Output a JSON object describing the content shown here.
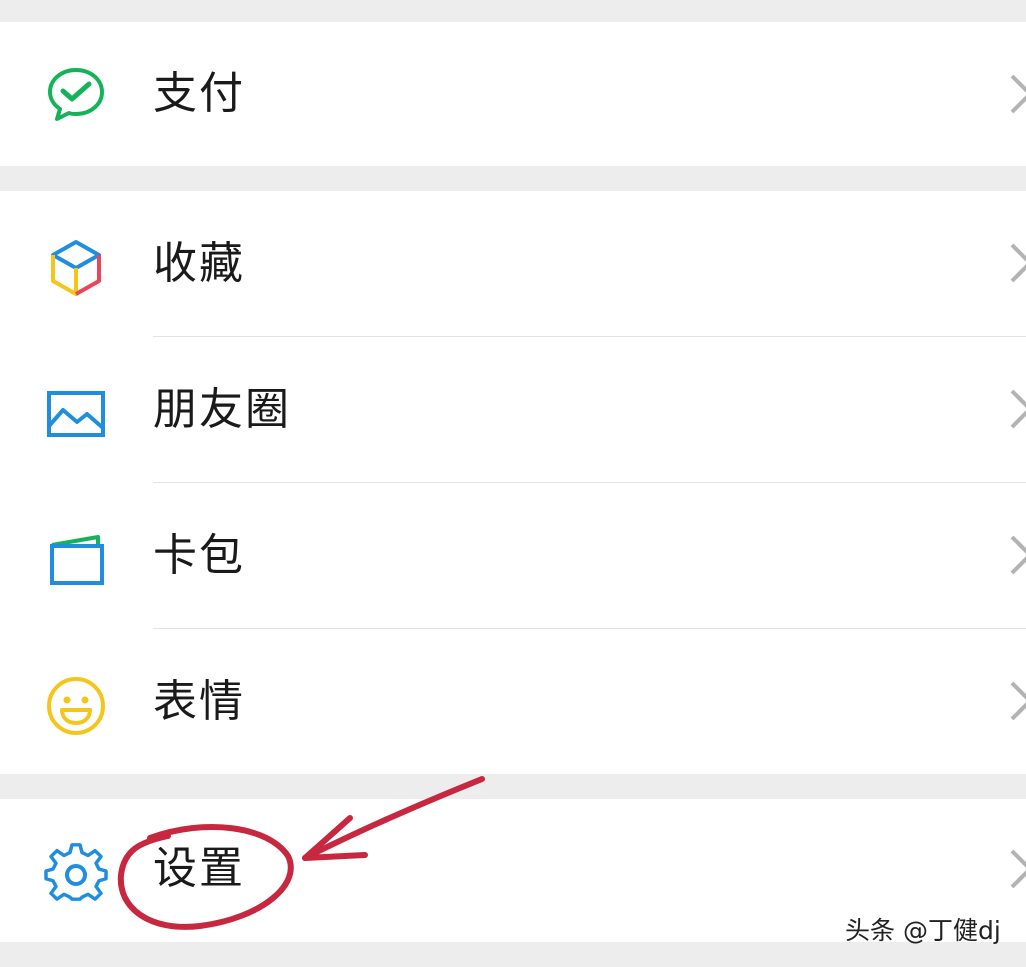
{
  "menu": {
    "pay": {
      "label": "支付",
      "icon": "wechat-pay-icon"
    },
    "favorites": {
      "label": "收藏",
      "icon": "favorites-cube-icon"
    },
    "moments": {
      "label": "朋友圈",
      "icon": "moments-picture-icon"
    },
    "cards": {
      "label": "卡包",
      "icon": "card-wallet-icon"
    },
    "stickers": {
      "label": "表情",
      "icon": "smiley-icon"
    },
    "settings": {
      "label": "设置",
      "icon": "gear-icon"
    }
  },
  "colors": {
    "background": "#ededed",
    "row": "#ffffff",
    "pay_green": "#14b35a",
    "blue": "#1f8de0",
    "smiley_yellow": "#f5c51b",
    "annotation_red": "#c8283f"
  },
  "watermark": {
    "text": "头条 @丁健dj"
  }
}
